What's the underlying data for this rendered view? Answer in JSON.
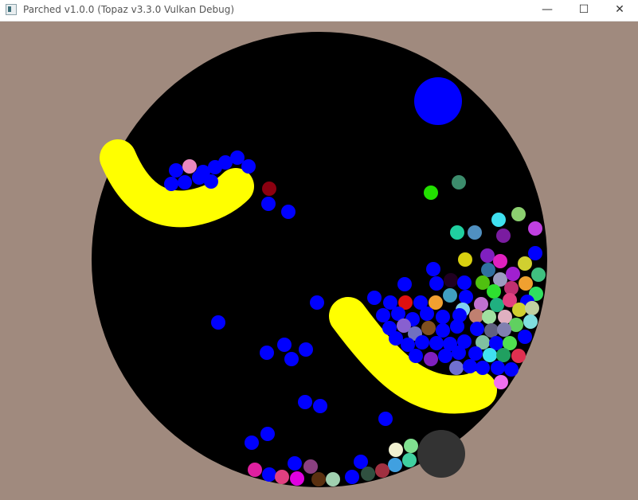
{
  "window": {
    "title": "Parched v1.0.0 (Topaz v3.3.0 Vulkan Debug)",
    "minimize_glyph": "—",
    "maximize_glyph": "☐",
    "close_glyph": "✕",
    "icon": "app-window-icon"
  },
  "scene": {
    "background_color": "#a08a7e",
    "arena_color": "#000000",
    "yellow_bar_color": "#ffff00",
    "blue_ball_color": "#0000ff",
    "large_blue_ball_color": "#0000ff",
    "grey_ball_color": "#333333"
  }
}
